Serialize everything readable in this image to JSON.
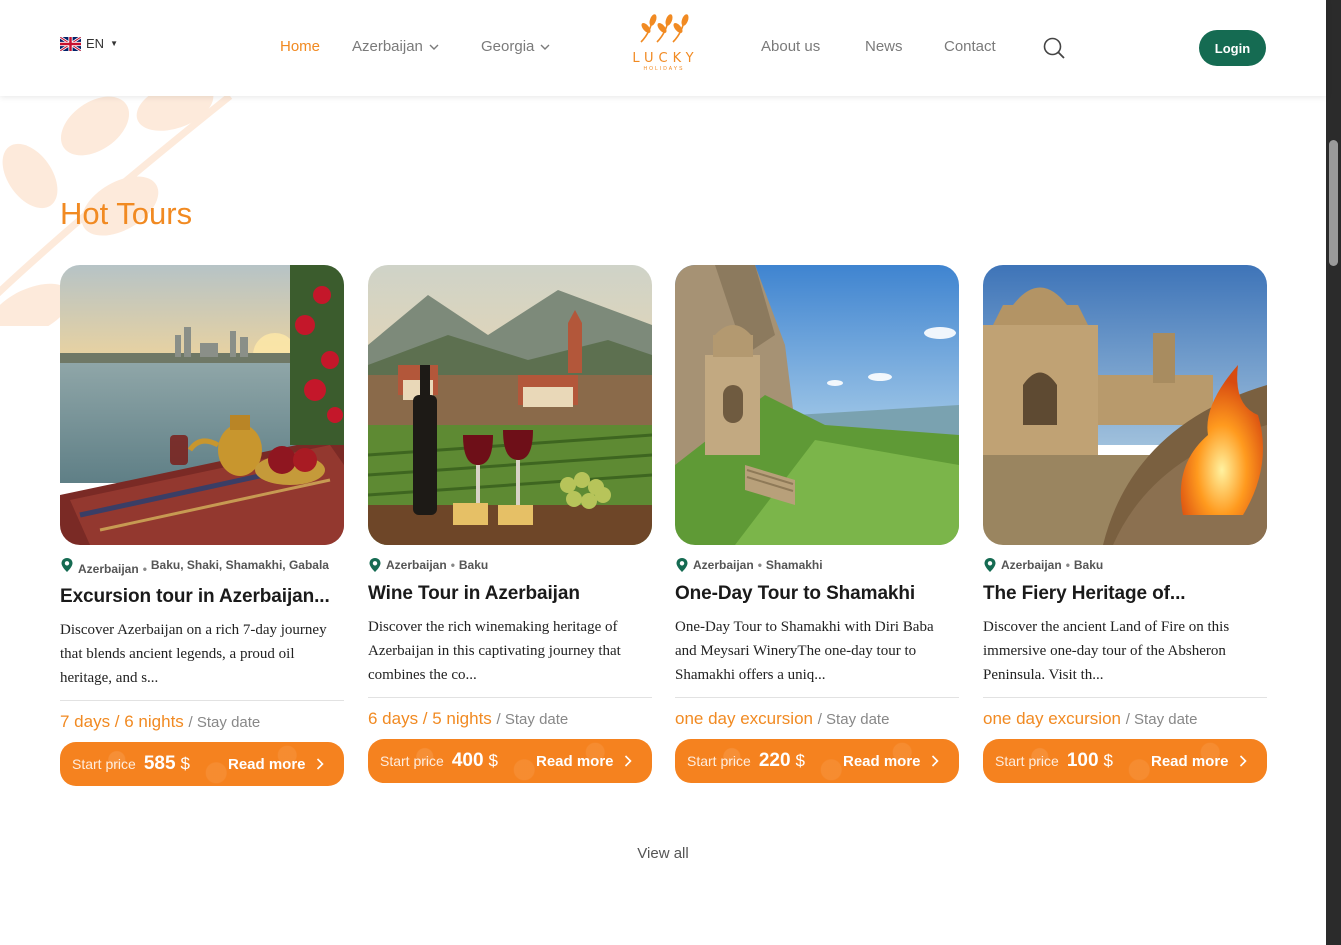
{
  "header": {
    "language": "EN",
    "nav": {
      "home": "Home",
      "azerbaijan": "Azerbaijan",
      "georgia": "Georgia",
      "about": "About us",
      "news": "News",
      "contact": "Contact"
    },
    "logo": {
      "word": "LUCKY",
      "sub": "HOLIDAYS"
    },
    "login": "Login"
  },
  "section": {
    "title": "Hot Tours",
    "view_all": "View all"
  },
  "colors": {
    "accent": "#f18a22",
    "button": "#f5821f",
    "brand_green": "#156b52"
  },
  "cards": [
    {
      "country": "Azerbaijan",
      "cities": "Baku, Shaki, Shamakhi, Gabala",
      "title": "Excursion tour in Azerbaijan...",
      "description": "Discover Azerbaijan on a rich 7-day journey that blends ancient legends, a proud oil heritage, and s...",
      "duration": "7 days / 6 nights",
      "stay": "/ Stay date",
      "price_label": "Start price",
      "price": "585",
      "currency": "$",
      "read_more": "Read more"
    },
    {
      "country": "Azerbaijan",
      "cities": "Baku",
      "title": "Wine Tour in Azerbaijan",
      "description": "Discover the rich winemaking heritage of Azerbaijan in this captivating journey that combines the co...",
      "duration": "6 days / 5 nights",
      "stay": "/ Stay date",
      "price_label": "Start price",
      "price": "400",
      "currency": "$",
      "read_more": "Read more"
    },
    {
      "country": "Azerbaijan",
      "cities": "Shamakhi",
      "title": "One-Day Tour to Shamakhi",
      "description": "One-Day Tour to Shamakhi with Diri Baba and Meysari WineryThe one-day tour to Shamakhi offers a uniq...",
      "duration": "one day excursion",
      "stay": "/ Stay date",
      "price_label": "Start price",
      "price": "220",
      "currency": "$",
      "read_more": "Read more"
    },
    {
      "country": "Azerbaijan",
      "cities": "Baku",
      "title": "The Fiery Heritage of...",
      "description": "Discover the ancient Land of Fire on this immersive one-day tour of the Absheron Peninsula. Visit th...",
      "duration": "one day excursion",
      "stay": "/ Stay date",
      "price_label": "Start price",
      "price": "100",
      "currency": "$",
      "read_more": "Read more"
    }
  ]
}
